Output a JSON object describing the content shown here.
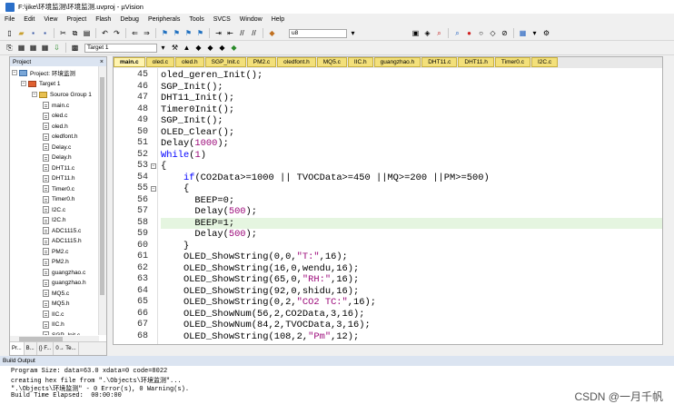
{
  "window": {
    "title": "F:\\jike\\环境监测\\环境监测.uvproj - µVision"
  },
  "menu": [
    "File",
    "Edit",
    "View",
    "Project",
    "Flash",
    "Debug",
    "Peripherals",
    "Tools",
    "SVCS",
    "Window",
    "Help"
  ],
  "toolbar": {
    "find_value": "u8",
    "target_value": "Target 1"
  },
  "project": {
    "header": "Project",
    "root": "Project: 环境监测",
    "target": "Target 1",
    "group": "Source Group 1",
    "files": [
      "main.c",
      "oled.c",
      "oled.h",
      "oledfont.h",
      "Delay.c",
      "Delay.h",
      "DHT11.c",
      "DHT11.h",
      "Timer0.c",
      "Timer0.h",
      "I2C.c",
      "I2C.h",
      "ADC1115.c",
      "ADC1115.h",
      "PM2.c",
      "PM2.h",
      "guangzhao.c",
      "guangzhao.h",
      "MQ5.c",
      "MQ5.h",
      "IIC.c",
      "IIC.h",
      "SGP_Init.c"
    ],
    "bottom_tabs": [
      "Pr...",
      "B...",
      "{} F...",
      "0→ Te..."
    ]
  },
  "editor": {
    "tabs": [
      "main.c",
      "oled.c",
      "oled.h",
      "SGP_Init.c",
      "PM2.c",
      "oledfont.h",
      "MQ5.c",
      "IIC.h",
      "guangzhao.h",
      "DHT11.c",
      "DHT11.h",
      "Timer0.c",
      "I2C.c"
    ],
    "active_tab": "main.c",
    "highlight_line": 58,
    "lines": [
      {
        "n": "45",
        "t": "oled_geren_Init();"
      },
      {
        "n": "46",
        "t": "SGP_Init();"
      },
      {
        "n": "47",
        "t": "DHT11_Init();"
      },
      {
        "n": "48",
        "t": "Timer0Init();"
      },
      {
        "n": "49",
        "t": "SGP_Init();"
      },
      {
        "n": "50",
        "t": "OLED_Clear();"
      },
      {
        "n": "51",
        "t": "Delay(1000);"
      },
      {
        "n": "52",
        "t": "While(1)"
      },
      {
        "n": "53",
        "t": "{"
      },
      {
        "n": "54",
        "t": "    if(CO2Data>=1000 || TVOCData>=450 ||MQ>=200 ||PM>=500)"
      },
      {
        "n": "55",
        "t": "    {"
      },
      {
        "n": "56",
        "t": "      BEEP=0;"
      },
      {
        "n": "57",
        "t": "      Delay(500);"
      },
      {
        "n": "58",
        "t": "      BEEP=1;"
      },
      {
        "n": "59",
        "t": "      Delay(500);"
      },
      {
        "n": "60",
        "t": "    }"
      },
      {
        "n": "61",
        "t": "    OLED_ShowString(0,0,\"T:\",16);"
      },
      {
        "n": "62",
        "t": "    OLED_ShowString(16,0,wendu,16);"
      },
      {
        "n": "63",
        "t": "    OLED_ShowString(65,0,\"RH:\",16);"
      },
      {
        "n": "64",
        "t": "    OLED_ShowString(92,0,shidu,16);"
      },
      {
        "n": "65",
        "t": "    OLED_ShowString(0,2,\"CO2 TC:\",16);"
      },
      {
        "n": "66",
        "t": "    OLED_ShowNum(56,2,CO2Data,3,16);"
      },
      {
        "n": "67",
        "t": "    OLED_ShowNum(84,2,TVOCData,3,16);"
      },
      {
        "n": "68",
        "t": "    OLED_ShowString(108,2,\"Pm\",12);"
      }
    ]
  },
  "build": {
    "header": "Build Output",
    "lines": [
      "Program Size: data=63.0 xdata=0 code=8022",
      "creating hex file from \".\\Objects\\环境监测\"...",
      "\".\\Objects\\环境监测\" - 0 Error(s), 0 Warning(s).",
      "Build Time Elapsed:  00:00:00"
    ]
  },
  "watermark": "CSDN @一月千帆",
  "colors": {
    "keyword": "#0000ff",
    "string": "#9c0a7a",
    "tab": "#f3e07a",
    "highlight": "#e5f5e0"
  }
}
